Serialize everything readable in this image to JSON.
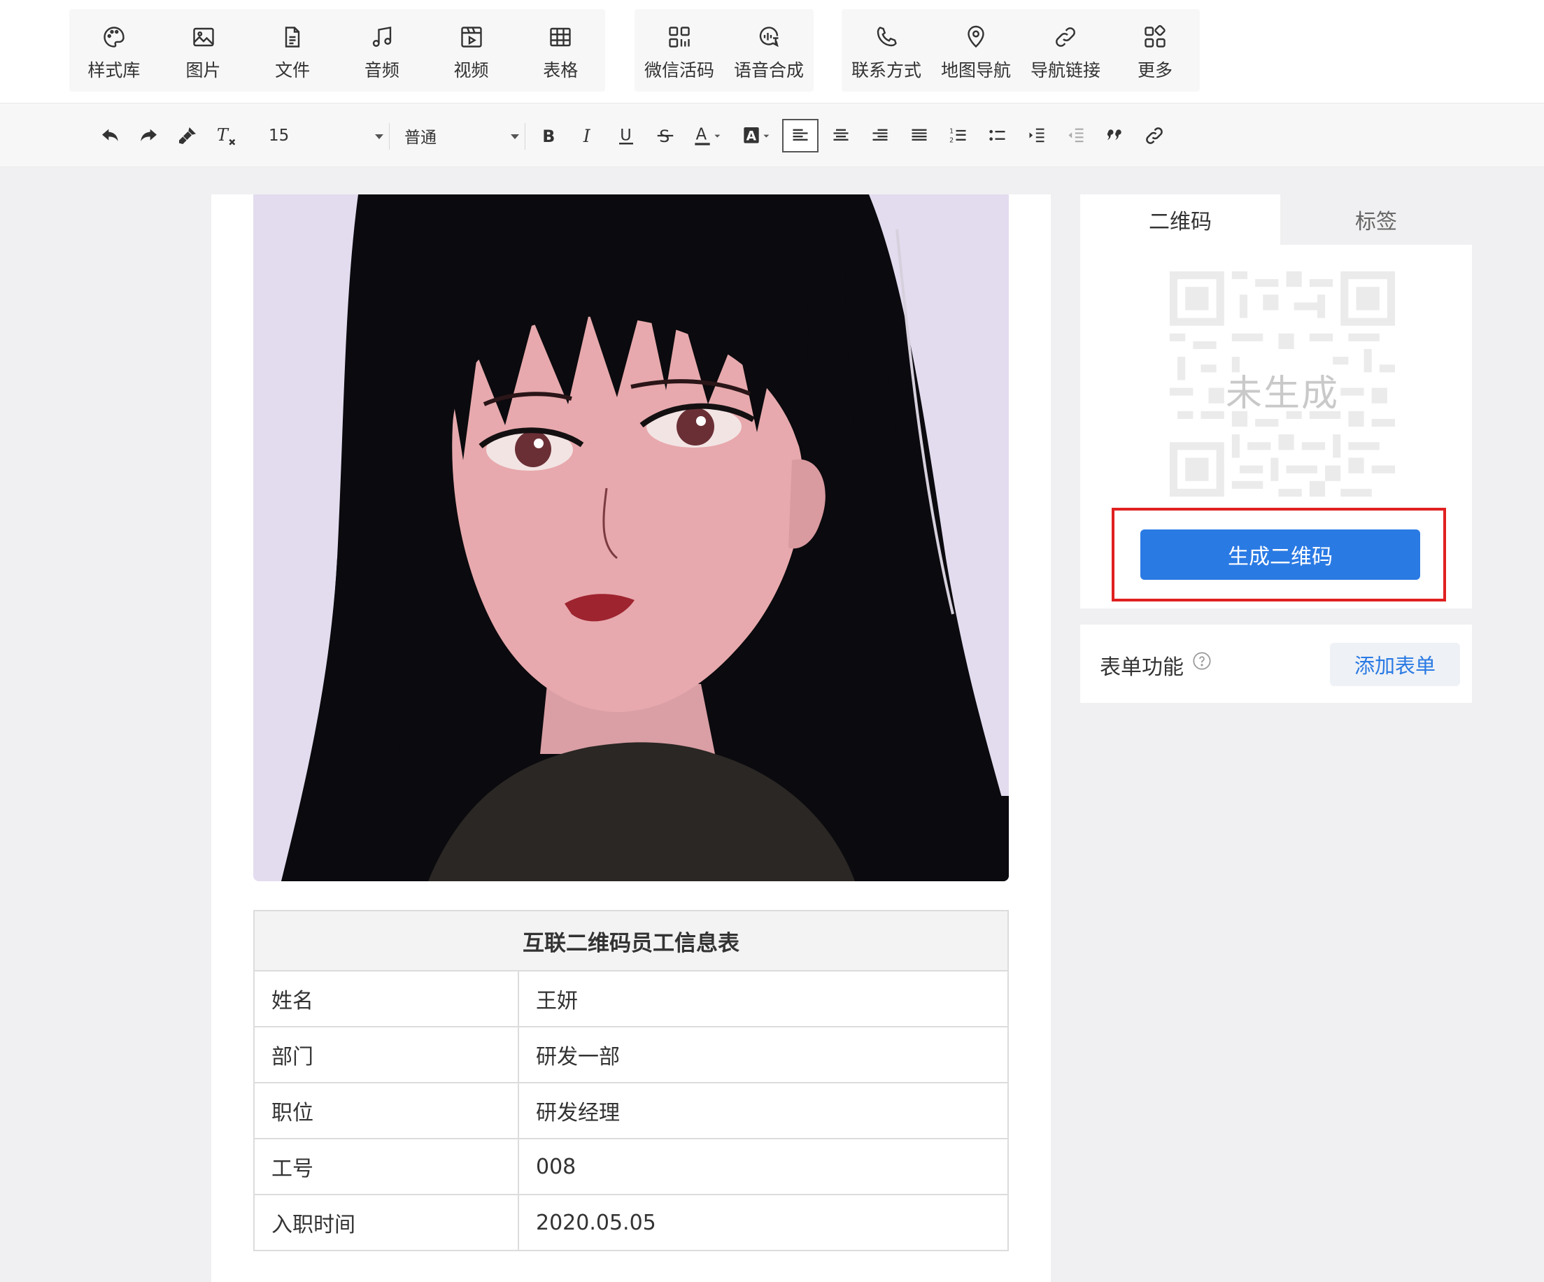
{
  "insert_toolbar": {
    "tools": [
      {
        "label": "样式库",
        "icon": "palette-icon"
      },
      {
        "label": "图片",
        "icon": "image-icon"
      },
      {
        "label": "文件",
        "icon": "file-icon"
      },
      {
        "label": "音频",
        "icon": "music-icon"
      },
      {
        "label": "视频",
        "icon": "video-icon"
      },
      {
        "label": "表格",
        "icon": "table-icon"
      },
      {
        "label": "微信活码",
        "icon": "live-code-icon"
      },
      {
        "label": "语音合成",
        "icon": "speech-synthesis-icon"
      },
      {
        "label": "联系方式",
        "icon": "phone-icon"
      },
      {
        "label": "地图导航",
        "icon": "map-pin-icon"
      },
      {
        "label": "导航链接",
        "icon": "link-icon"
      },
      {
        "label": "更多",
        "icon": "more-grid-icon"
      }
    ]
  },
  "format_toolbar": {
    "font_size": "15",
    "paragraph_style": "普通",
    "active_button": "align-left"
  },
  "document": {
    "image_alt": "anime-style portrait of a woman with long black hair",
    "table": {
      "title": "互联二维码员工信息表",
      "rows": [
        {
          "key": "姓名",
          "value": "王妍"
        },
        {
          "key": "部门",
          "value": "研发一部"
        },
        {
          "key": "职位",
          "value": "研发经理"
        },
        {
          "key": "工号",
          "value": "008"
        },
        {
          "key": "入职时间",
          "value": "2020.05.05"
        }
      ]
    }
  },
  "side_panel": {
    "tabs": [
      "二维码",
      "标签"
    ],
    "active_tab": "二维码",
    "qr_placeholder_text": "未生成",
    "generate_button": "生成二维码",
    "form_label": "表单功能",
    "add_form_button": "添加表单"
  },
  "colors": {
    "accent": "#2a7ae4",
    "highlight_box": "#e02020",
    "page_bg": "#f0f0f2"
  }
}
